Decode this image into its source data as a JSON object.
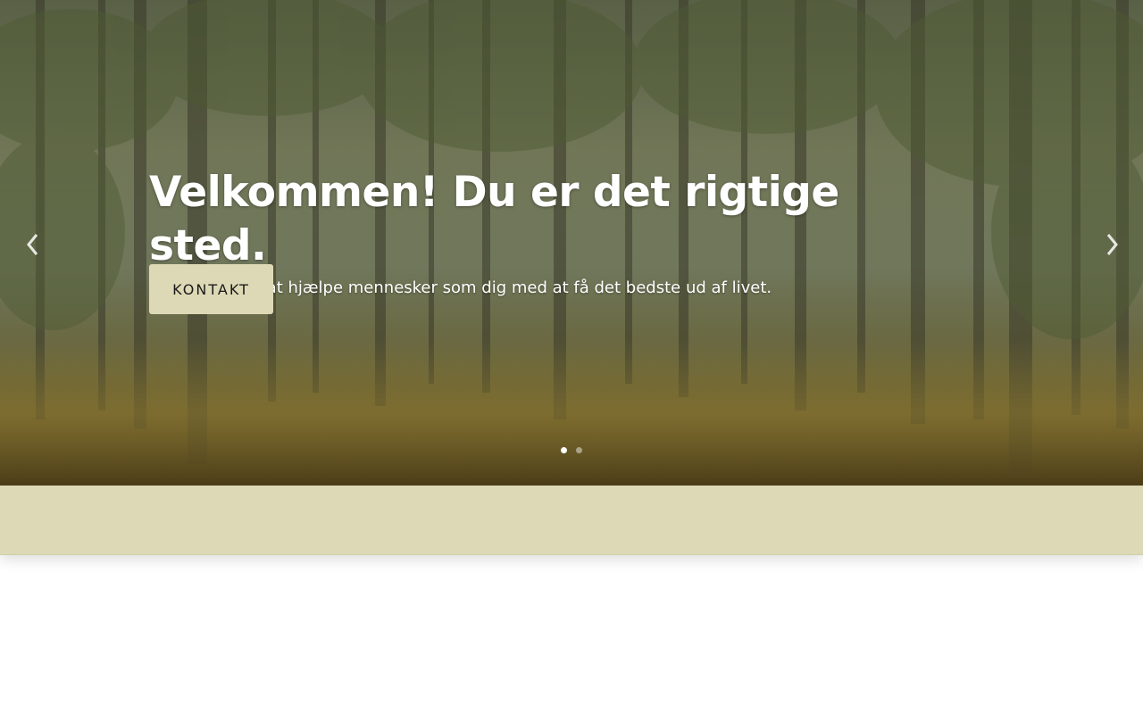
{
  "hero": {
    "title": "Velkommen! Du er det rigtige sted.",
    "subtitle": "Mit arbejde er at hjælpe mennesker som dig med at få det bedste ud af livet.",
    "cta_label": "KONTAKT",
    "prev_icon": "chevron-left-icon",
    "next_icon": "chevron-right-icon",
    "slides_total": 2,
    "slide_active": 1
  },
  "colors": {
    "accent": "#ddd9b6",
    "hero_text": "#ffffff",
    "button_text": "#1a1a1a",
    "band_border": "#c9d3a8"
  }
}
